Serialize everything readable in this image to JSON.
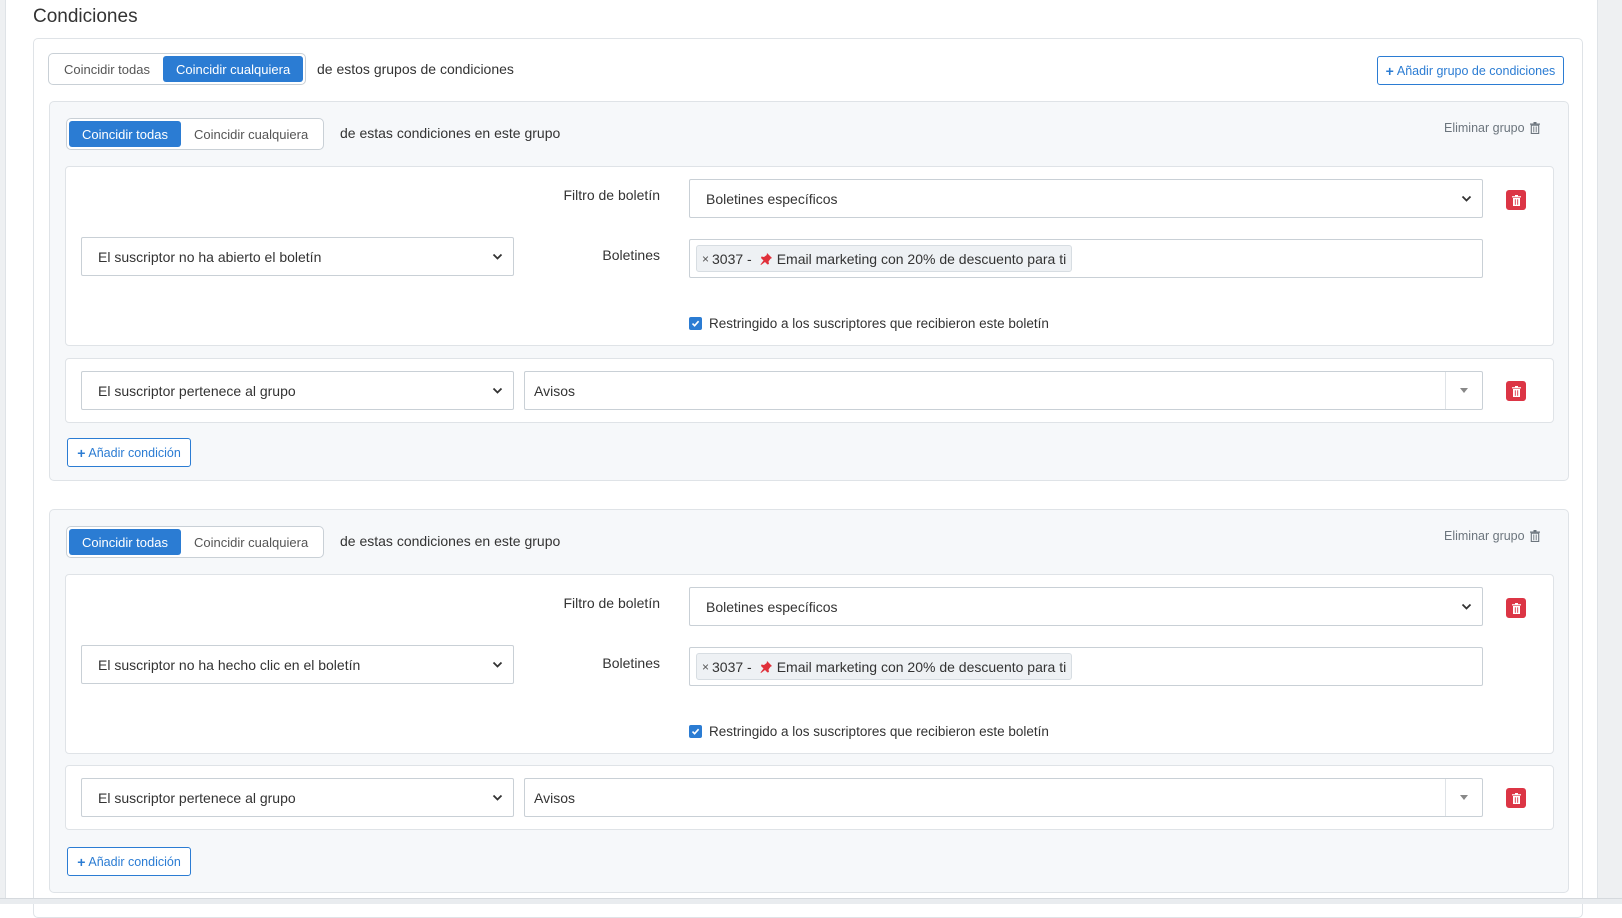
{
  "section_title": "Condiciones",
  "top": {
    "match_options": [
      "Coincidir todas",
      "Coincidir cualquiera"
    ],
    "active_index": 1,
    "description": "de estos grupos de condiciones",
    "add_group_label": "Añadir grupo de condiciones"
  },
  "groups": [
    {
      "match_options": [
        "Coincidir todas",
        "Coincidir cualquiera"
      ],
      "active_index": 0,
      "description": "de estas condiciones en este grupo",
      "remove_label": "Eliminar grupo",
      "add_condition_label": "Añadir condición",
      "conditions": [
        {
          "type": "El suscriptor no ha abierto el boletín",
          "filter_label": "Filtro de boletín",
          "filter_value": "Boletines específicos",
          "newsletters_label": "Boletines",
          "tag": {
            "remove": "×",
            "id": "3037 -",
            "title": "Email marketing con 20% de descuento para ti"
          },
          "checkbox_label": "Restringido a los suscriptores que recibieron este boletín",
          "checked": true
        },
        {
          "type": "El suscriptor pertenece al grupo",
          "value": "Avisos"
        }
      ]
    },
    {
      "match_options": [
        "Coincidir todas",
        "Coincidir cualquiera"
      ],
      "active_index": 0,
      "description": "de estas condiciones en este grupo",
      "remove_label": "Eliminar grupo",
      "add_condition_label": "Añadir condición",
      "conditions": [
        {
          "type": "El suscriptor no ha hecho clic en el boletín",
          "filter_label": "Filtro de boletín",
          "filter_value": "Boletines específicos",
          "newsletters_label": "Boletines",
          "tag": {
            "remove": "×",
            "id": "3037 -",
            "title": "Email marketing con 20% de descuento para ti"
          },
          "checkbox_label": "Restringido a los suscriptores que recibieron este boletín",
          "checked": true
        },
        {
          "type": "El suscriptor pertenece al grupo",
          "value": "Avisos"
        }
      ]
    }
  ],
  "colors": {
    "primary": "#2b7cd3",
    "danger": "#dc3545",
    "panel": "#f6f8fa",
    "border": "#dfe3e7"
  }
}
